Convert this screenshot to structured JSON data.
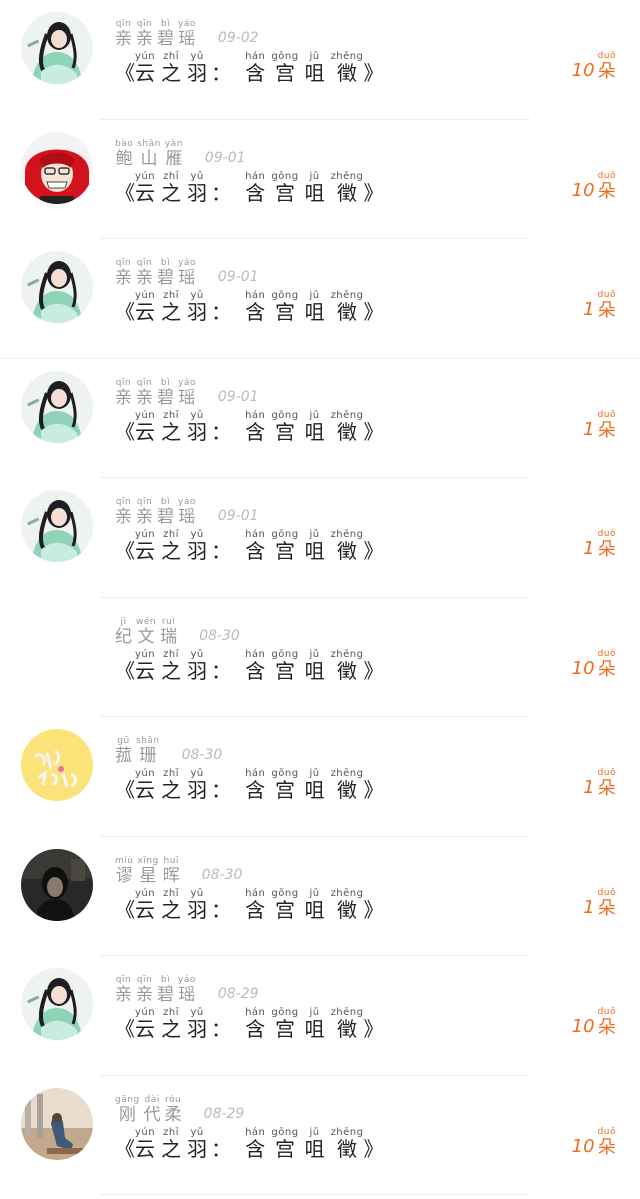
{
  "gift_pinyin": [
    "yún",
    "zhī",
    "yǔ",
    "hán",
    "gōng",
    "jǔ",
    "zhēng"
  ],
  "gift_hanzi": [
    "云",
    "之",
    "羽",
    "含",
    "宫",
    "咀",
    "徵"
  ],
  "gift_open": "《",
  "gift_colon": "：",
  "gift_close": "》",
  "unit": {
    "py": "duǒ",
    "hz": "朵"
  },
  "colors": {
    "accent": "#f06b20"
  },
  "rows": [
    {
      "name": [
        [
          "qīn",
          "亲"
        ],
        [
          "qīn",
          "亲"
        ],
        [
          "bì",
          "碧"
        ],
        [
          "yáo",
          "瑶"
        ]
      ],
      "date": "09-02",
      "count": "10",
      "avatar": "girl-avatar"
    },
    {
      "name": [
        [
          "bào",
          "鲍"
        ],
        [
          "shān",
          "山"
        ],
        [
          "yàn",
          "雁"
        ]
      ],
      "date": "09-01",
      "count": "10",
      "avatar": "red-hair-avatar"
    },
    {
      "name": [
        [
          "qīn",
          "亲"
        ],
        [
          "qīn",
          "亲"
        ],
        [
          "bì",
          "碧"
        ],
        [
          "yáo",
          "瑶"
        ]
      ],
      "date": "09-01",
      "count": "1",
      "avatar": "girl-avatar"
    },
    {
      "name": [
        [
          "qīn",
          "亲"
        ],
        [
          "qīn",
          "亲"
        ],
        [
          "bì",
          "碧"
        ],
        [
          "yáo",
          "瑶"
        ]
      ],
      "date": "09-01",
      "count": "1",
      "avatar": "girl-avatar"
    },
    {
      "name": [
        [
          "qīn",
          "亲"
        ],
        [
          "qīn",
          "亲"
        ],
        [
          "bì",
          "碧"
        ],
        [
          "yáo",
          "瑶"
        ]
      ],
      "date": "09-01",
      "count": "1",
      "avatar": "girl-avatar"
    },
    {
      "name": [
        [
          "jì",
          "纪"
        ],
        [
          "wén",
          "文"
        ],
        [
          "ruì",
          "瑞"
        ]
      ],
      "date": "08-30",
      "count": "10",
      "avatar": "none"
    },
    {
      "name": [
        [
          "gū",
          "菰"
        ],
        [
          "shān",
          "珊"
        ]
      ],
      "date": "08-30",
      "count": "1",
      "avatar": "yellow-avatar"
    },
    {
      "name": [
        [
          "miù",
          "谬"
        ],
        [
          "xīng",
          "星"
        ],
        [
          "huī",
          "晖"
        ]
      ],
      "date": "08-30",
      "count": "1",
      "avatar": "dark-avatar"
    },
    {
      "name": [
        [
          "qīn",
          "亲"
        ],
        [
          "qīn",
          "亲"
        ],
        [
          "bì",
          "碧"
        ],
        [
          "yáo",
          "瑶"
        ]
      ],
      "date": "08-29",
      "count": "10",
      "avatar": "girl-avatar"
    },
    {
      "name": [
        [
          "gāng",
          "刚"
        ],
        [
          "dài",
          "代"
        ],
        [
          "róu",
          "柔"
        ]
      ],
      "date": "08-29",
      "count": "10",
      "avatar": "photo-avatar"
    }
  ]
}
